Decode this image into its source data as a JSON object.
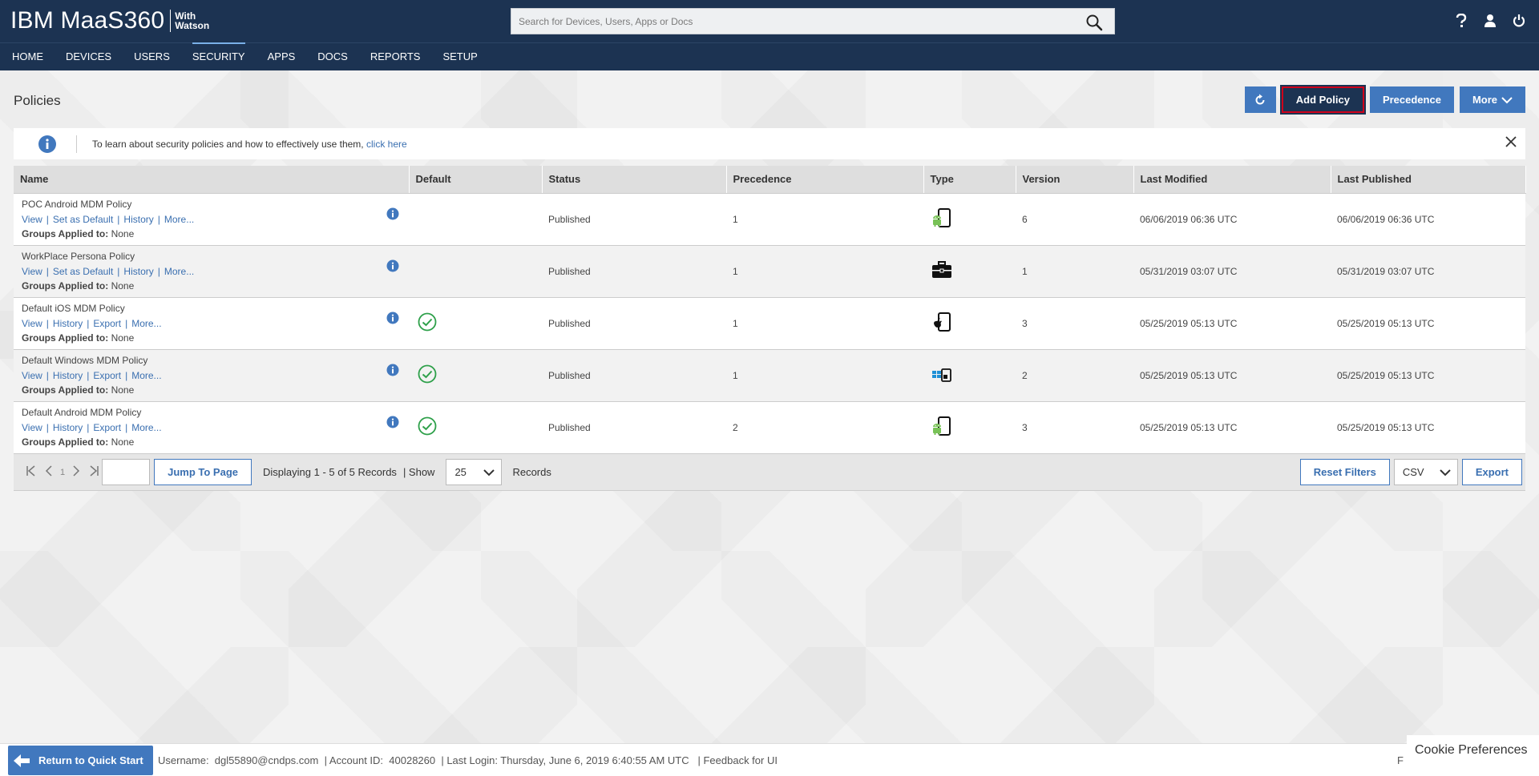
{
  "header": {
    "brand": "IBM MaaS360",
    "brand_sub_line1": "With",
    "brand_sub_line2": "Watson",
    "search_placeholder": "Search for Devices, Users, Apps or Docs"
  },
  "nav": [
    "HOME",
    "DEVICES",
    "USERS",
    "SECURITY",
    "APPS",
    "DOCS",
    "REPORTS",
    "SETUP"
  ],
  "nav_active": "SECURITY",
  "page": {
    "title": "Policies",
    "actions": {
      "add_policy": "Add Policy",
      "precedence": "Precedence",
      "more": "More"
    },
    "banner": {
      "text": "To learn about security policies and how to effectively use them,",
      "link": "click here"
    }
  },
  "table": {
    "columns": [
      "Name",
      "Default",
      "Status",
      "Precedence",
      "Type",
      "Version",
      "Last Modified",
      "Last Published"
    ],
    "groups_label": "Groups Applied to:",
    "rows": [
      {
        "name": "POC Android MDM Policy",
        "links": [
          "View",
          "Set as Default",
          "History",
          "More..."
        ],
        "groups": "None",
        "default": false,
        "status": "Published",
        "precedence": "1",
        "type_icon": "android-device-icon",
        "version": "6",
        "last_modified": "06/06/2019 06:36 UTC",
        "last_published": "06/06/2019 06:36 UTC"
      },
      {
        "name": "WorkPlace Persona Policy",
        "links": [
          "View",
          "Set as Default",
          "History",
          "More..."
        ],
        "groups": "None",
        "default": false,
        "status": "Published",
        "precedence": "1",
        "type_icon": "briefcase-icon",
        "version": "1",
        "last_modified": "05/31/2019 03:07 UTC",
        "last_published": "05/31/2019 03:07 UTC"
      },
      {
        "name": "Default iOS MDM Policy",
        "links": [
          "View",
          "History",
          "Export",
          "More..."
        ],
        "groups": "None",
        "default": true,
        "status": "Published",
        "precedence": "1",
        "type_icon": "ios-device-icon",
        "version": "3",
        "last_modified": "05/25/2019 05:13 UTC",
        "last_published": "05/25/2019 05:13 UTC"
      },
      {
        "name": "Default Windows MDM Policy",
        "links": [
          "View",
          "History",
          "Export",
          "More..."
        ],
        "groups": "None",
        "default": true,
        "status": "Published",
        "precedence": "1",
        "type_icon": "windows-device-icon",
        "version": "2",
        "last_modified": "05/25/2019 05:13 UTC",
        "last_published": "05/25/2019 05:13 UTC"
      },
      {
        "name": "Default Android MDM Policy",
        "links": [
          "View",
          "History",
          "Export",
          "More..."
        ],
        "groups": "None",
        "default": true,
        "status": "Published",
        "precedence": "2",
        "type_icon": "android-device-icon",
        "version": "3",
        "last_modified": "05/25/2019 05:13 UTC",
        "last_published": "05/25/2019 05:13 UTC"
      }
    ]
  },
  "pager": {
    "current_page": "1",
    "jump_label": "Jump To Page",
    "displaying": "Displaying 1 - 5 of 5 Records",
    "show_label": "| Show",
    "page_size": "25",
    "records_label": "Records",
    "reset_filters": "Reset Filters",
    "format": "CSV",
    "export": "Export"
  },
  "footer": {
    "quick_start": "Return to Quick Start",
    "info": "Username:  dgl55890@cndps.com  | Account ID:  40028260  | Last Login: Thursday, June 6, 2019 6:40:55 AM UTC   |",
    "feedback": "Feedback for UI",
    "trailing": "F",
    "cookie": "Cookie Preferences"
  },
  "colors": {
    "header_bg": "#1c3352",
    "accent": "#4178be",
    "highlight_border": "#d0021b",
    "check_green": "#2ea04a",
    "android_green": "#78c257",
    "windows_blue": "#1e90d6"
  }
}
